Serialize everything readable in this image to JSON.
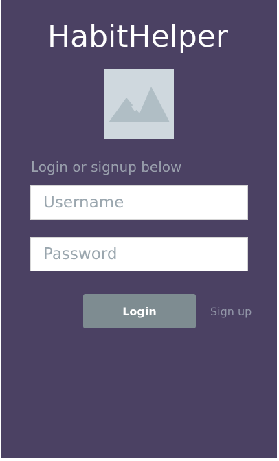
{
  "app": {
    "title": "HabitHelper",
    "logo_icon": "image-placeholder-icon"
  },
  "login": {
    "subtitle": "Login or signup below",
    "username_placeholder": "Username",
    "username_value": "",
    "password_placeholder": "Password",
    "password_value": "",
    "login_label": "Login",
    "signup_label": "Sign up"
  },
  "colors": {
    "background": "#4b4163",
    "title_text": "#ffffff",
    "subtitle_text": "#9aa0ad",
    "logo_bg": "#cfd8de",
    "logo_shape": "#b0bec5",
    "button_bg": "#7e8c91",
    "link_text": "#9296a8"
  }
}
